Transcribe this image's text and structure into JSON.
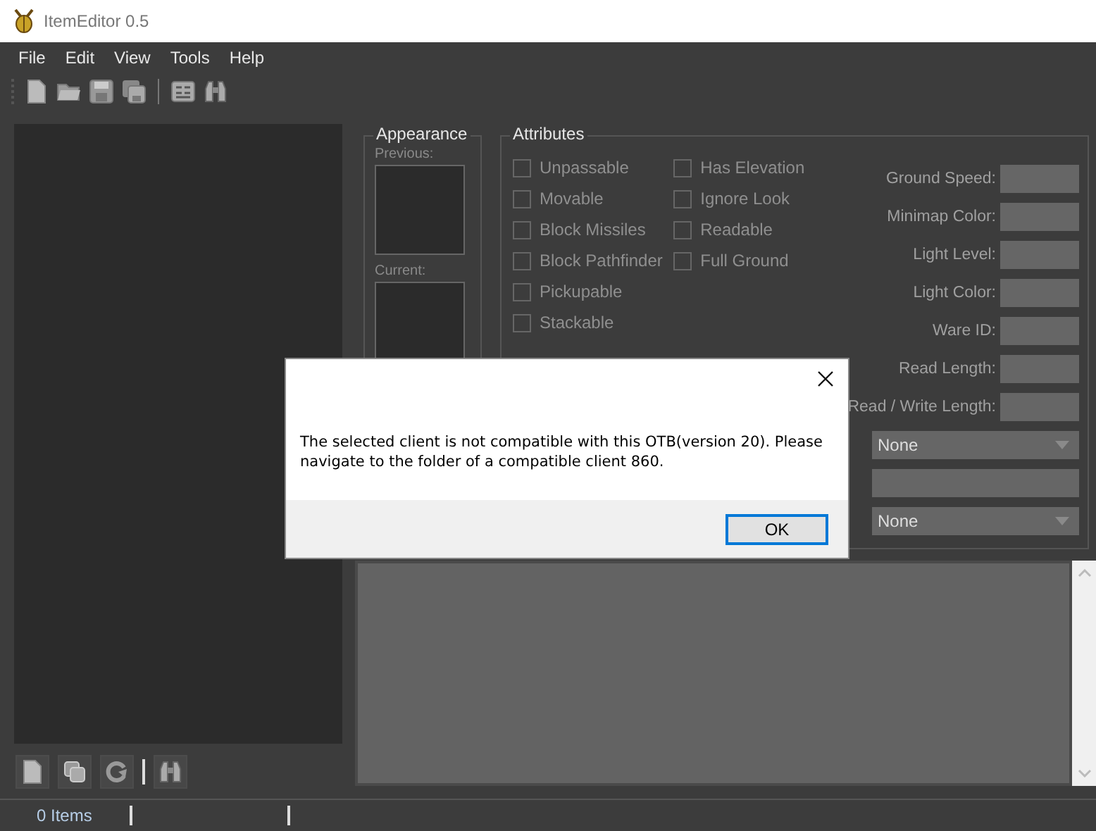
{
  "window": {
    "title": "ItemEditor 0.5"
  },
  "menu": [
    "File",
    "Edit",
    "View",
    "Tools",
    "Help"
  ],
  "appearance": {
    "title": "Appearance",
    "previous_label": "Previous:",
    "current_label": "Current:"
  },
  "attributes": {
    "title": "Attributes",
    "flags_left": [
      {
        "label": "Unpassable",
        "checked": false
      },
      {
        "label": "Movable",
        "checked": false
      },
      {
        "label": "Block Missiles",
        "checked": false
      },
      {
        "label": "Block Pathfinder",
        "checked": false
      },
      {
        "label": "Pickupable",
        "checked": false
      },
      {
        "label": "Stackable",
        "checked": false
      }
    ],
    "flags_right": [
      {
        "label": "Has Elevation",
        "checked": false
      },
      {
        "label": "Ignore Look",
        "checked": false
      },
      {
        "label": "Readable",
        "checked": false
      },
      {
        "label": "Full Ground",
        "checked": false
      }
    ],
    "fields": [
      {
        "label": "Ground Speed:"
      },
      {
        "label": "Minimap Color:"
      },
      {
        "label": "Light Level:"
      },
      {
        "label": "Light Color:"
      },
      {
        "label": "Ware ID:"
      },
      {
        "label": "Read Length:"
      },
      {
        "label": "Read / Write Length:"
      }
    ],
    "selectors": [
      {
        "kind": "dropdown",
        "value": "None"
      },
      {
        "kind": "text"
      },
      {
        "kind": "dropdown",
        "value": "None"
      }
    ]
  },
  "status_bar": {
    "count": "0 Items"
  },
  "dialog": {
    "message": "The selected client is not compatible with this OTB(version 20). Please navigate to the folder of a compatible client 860.",
    "button": "OK"
  }
}
